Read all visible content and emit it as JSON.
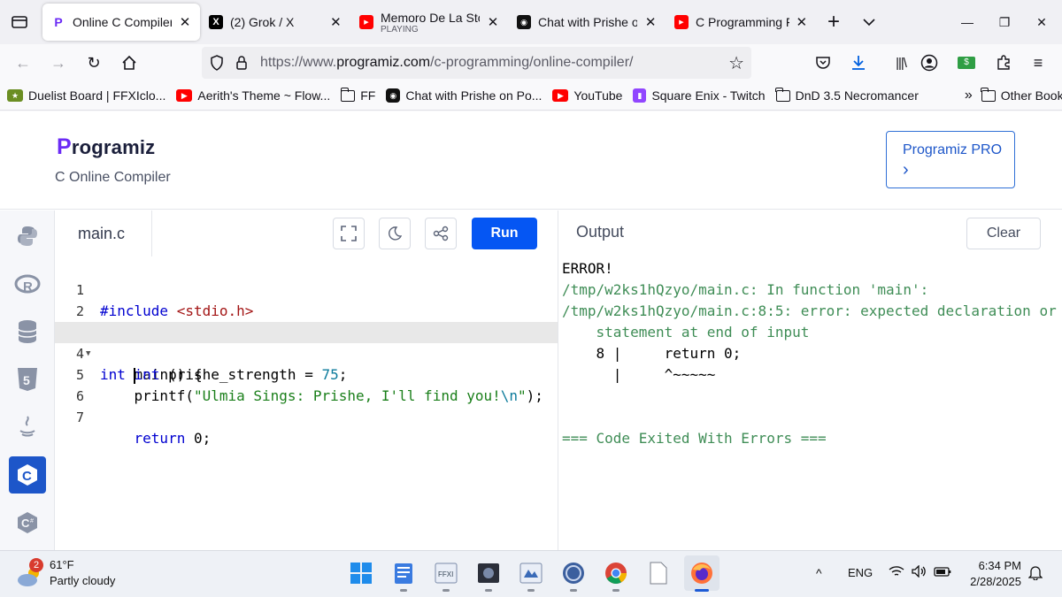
{
  "browser": {
    "tabs": [
      {
        "title": "Online C Compiler -",
        "icon": "programiz-icon",
        "active": true
      },
      {
        "title": "(2) Grok / X",
        "icon": "x-icon"
      },
      {
        "title": "Memoro De La Stor",
        "subtitle": "PLAYING",
        "icon": "youtube-icon"
      },
      {
        "title": "Chat with Prishe on",
        "icon": "chat-icon"
      },
      {
        "title": "C Programming Full",
        "icon": "youtube-icon"
      }
    ],
    "url_prefix": "https://www.",
    "url_host": "programiz.com",
    "url_path": "/c-programming/online-compiler/",
    "bookmarks": [
      {
        "label": "Duelist Board | FFXIclo...",
        "icon": "game-icon"
      },
      {
        "label": "Aerith's Theme ~ Flow...",
        "icon": "youtube-icon"
      },
      {
        "label": "FF",
        "icon": "folder-icon"
      },
      {
        "label": "Chat with Prishe on Po...",
        "icon": "chat-icon"
      },
      {
        "label": "YouTube",
        "icon": "youtube-icon"
      },
      {
        "label": "Square Enix - Twitch",
        "icon": "twitch-icon"
      },
      {
        "label": "DnD 3.5 Necromancer",
        "icon": "folder-icon"
      }
    ],
    "other_bookmarks": "Other Bookmarks",
    "colors": {
      "youtube": "#ff0000",
      "programiz": "#6b2bf5",
      "twitch": "#9146ff"
    }
  },
  "site": {
    "logo": "rogramiz",
    "logo_letter": "P",
    "subtitle": "C Online Compiler",
    "pro_button": "Programiz PRO",
    "pro_arrow": "›",
    "languages": [
      "python-icon",
      "r-icon",
      "sql-icon",
      "html5-icon",
      "java-icon",
      "c-icon",
      "csharp-icon"
    ],
    "active_language": "c-icon",
    "accent": "#0556f3"
  },
  "editor": {
    "filename": "main.c",
    "run_label": "Run",
    "line_numbers": [
      "1",
      "2",
      "3",
      "4",
      "5",
      "6",
      "7"
    ],
    "current_line": "4",
    "code": {
      "l1_kw": "#include ",
      "l1_str": "<stdio.h>",
      "l3_kw": "int",
      "l3_rest": " main() {",
      "l4_indent": "    ",
      "l4_kw": "int",
      "l4_rest": " prishe_strength = ",
      "l4_num": "75",
      "l4_end": ";",
      "l5_indent": "    printf(",
      "l5_str": "\"Ulmia Sings: Prishe, I'll find you!",
      "l5_esc": "\\n",
      "l5_strend": "\"",
      "l5_end": ");",
      "l7_indent": "    ",
      "l7_kw": "return",
      "l7_rest": " 0;"
    }
  },
  "output": {
    "title": "Output",
    "clear_label": "Clear",
    "lines": [
      "ERROR!",
      "/tmp/w2ks1hQzyo/main.c: In function 'main':",
      "/tmp/w2ks1hQzyo/main.c:8:5: error: expected declaration or",
      "    statement at end of input",
      "    8 |     return 0;",
      "      |     ^~~~~~",
      "",
      "",
      "=== Code Exited With Errors ==="
    ]
  },
  "taskbar": {
    "weather_temp": "61°F",
    "weather_desc": "Partly cloudy",
    "weather_badge": "2",
    "language": "ENG",
    "time": "6:34 PM",
    "date": "2/28/2025"
  }
}
